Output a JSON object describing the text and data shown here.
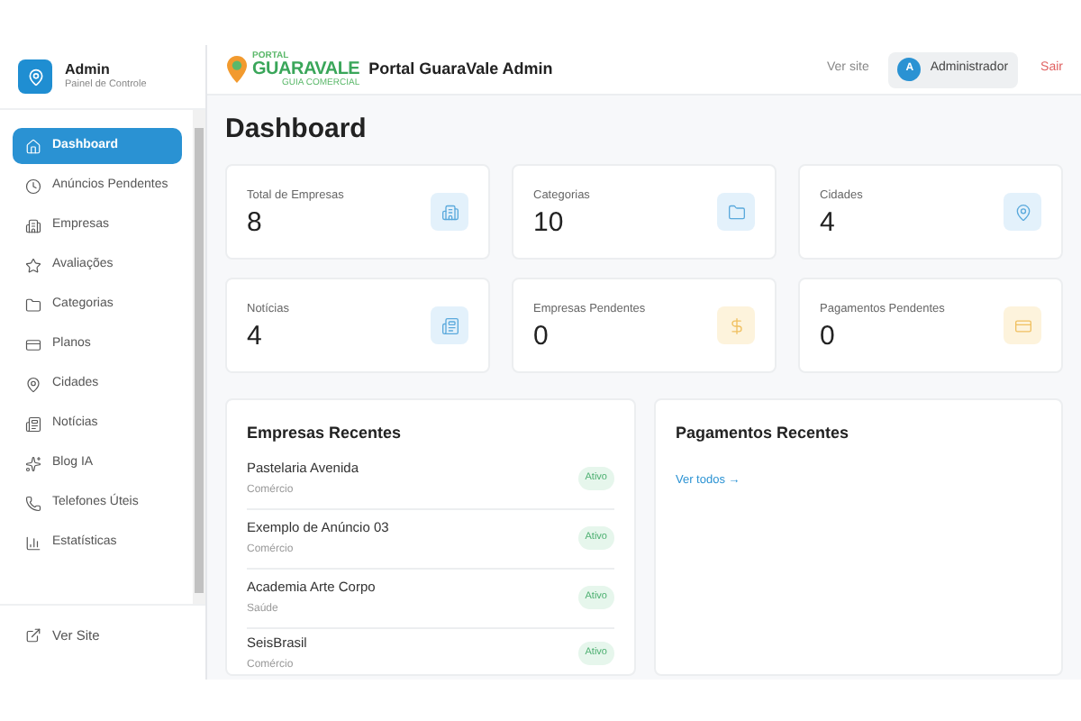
{
  "sidebar": {
    "title": "Admin",
    "subtitle": "Painel de Controle",
    "items": [
      {
        "label": "Dashboard",
        "selected": true
      },
      {
        "label": "Anúncios Pendentes",
        "selected": false
      },
      {
        "label": "Empresas",
        "selected": false
      },
      {
        "label": "Avaliações",
        "selected": false
      },
      {
        "label": "Categorias",
        "selected": false
      },
      {
        "label": "Planos",
        "selected": false
      },
      {
        "label": "Cidades",
        "selected": false
      },
      {
        "label": "Notícias",
        "selected": false
      },
      {
        "label": "Blog IA",
        "selected": false
      },
      {
        "label": "Telefones Úteis",
        "selected": false
      },
      {
        "label": "Estatísticas",
        "selected": false
      }
    ],
    "footer_link": "Ver Site"
  },
  "topbar": {
    "logo": {
      "top": "PORTAL",
      "main": "GUARAVALE",
      "sub": "GUIA COMERCIAL"
    },
    "title": "Portal GuaraVale Admin",
    "view_site": "Ver site",
    "user_initial": "A",
    "user_name": "Administrador",
    "logout": "Sair"
  },
  "page_title": "Dashboard",
  "stats": [
    {
      "label": "Total de Empresas",
      "value": "8"
    },
    {
      "label": "Categorias",
      "value": "10"
    },
    {
      "label": "Cidades",
      "value": "4"
    },
    {
      "label": "Notícias",
      "value": "4"
    },
    {
      "label": "Empresas Pendentes",
      "value": "0"
    },
    {
      "label": "Pagamentos Pendentes",
      "value": "0"
    }
  ],
  "recent_companies": {
    "title": "Empresas Recentes",
    "rows": [
      {
        "name": "Pastelaria Avenida",
        "category": "Comércio",
        "status": "Ativo"
      },
      {
        "name": "Exemplo de Anúncio 03",
        "category": "Comércio",
        "status": "Ativo"
      },
      {
        "name": "Academia Arte Corpo",
        "category": "Saúde",
        "status": "Ativo"
      },
      {
        "name": "SeisBrasil",
        "category": "Comércio",
        "status": "Ativo"
      }
    ]
  },
  "recent_payments": {
    "title": "Pagamentos Recentes",
    "link": "Ver todos →"
  }
}
